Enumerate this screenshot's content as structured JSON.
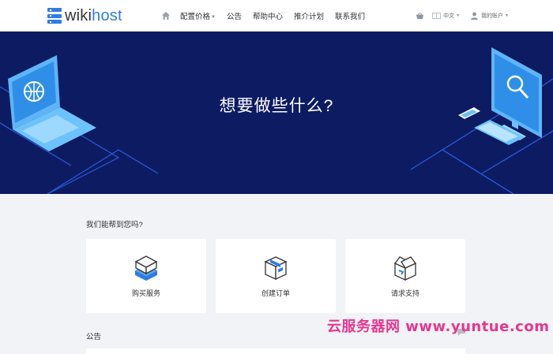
{
  "header": {
    "logo": {
      "prefix": "wiki",
      "suffix": "host"
    },
    "nav": [
      {
        "label": "配置价格",
        "has_dropdown": true
      },
      {
        "label": "公告",
        "has_dropdown": false
      },
      {
        "label": "帮助中心",
        "has_dropdown": false
      },
      {
        "label": "推介计划",
        "has_dropdown": false
      },
      {
        "label": "联系我们",
        "has_dropdown": false
      }
    ],
    "language": "中文",
    "account": "我的账户",
    "icons": {
      "home": "home-icon",
      "cart": "basket-icon",
      "language": "flag-icon",
      "account": "user-icon"
    }
  },
  "hero": {
    "title": "想要做些什么?"
  },
  "help": {
    "title": "我们能帮到您吗?",
    "cards": [
      {
        "label": "购买服务",
        "icon": "box-stack-icon"
      },
      {
        "label": "创建订单",
        "icon": "package-icon"
      },
      {
        "label": "请求支持",
        "icon": "open-box-icon"
      }
    ]
  },
  "announcements": {
    "title": "公告"
  },
  "watermark": "云服务器网 www.yuntue.com",
  "colors": {
    "brand": "#2f7de1",
    "hero_bg": "#0d1b63",
    "page_bg": "#f1f3f6",
    "watermark": "#e8368f"
  }
}
